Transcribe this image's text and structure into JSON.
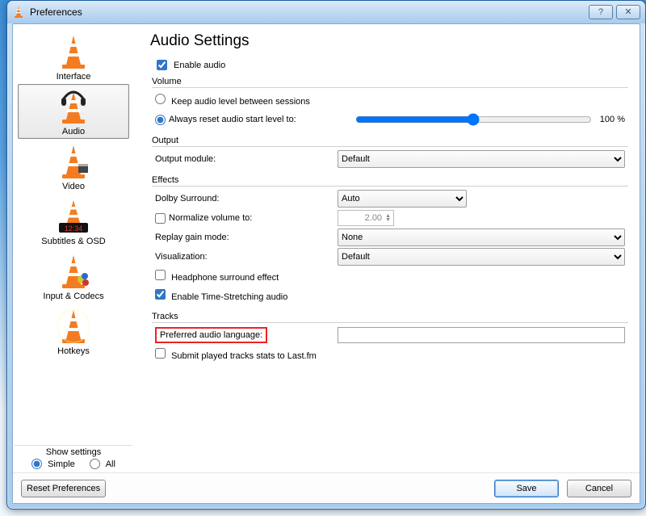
{
  "window": {
    "title": "Preferences"
  },
  "sidebar": {
    "items": [
      {
        "label": "Interface"
      },
      {
        "label": "Audio"
      },
      {
        "label": "Video"
      },
      {
        "label": "Subtitles & OSD"
      },
      {
        "label": "Input & Codecs"
      },
      {
        "label": "Hotkeys"
      }
    ],
    "show_label": "Show settings",
    "simple_label": "Simple",
    "all_label": "All"
  },
  "main": {
    "heading": "Audio Settings",
    "enable_audio_label": "Enable audio",
    "volume": {
      "group_title": "Volume",
      "keep_label": "Keep audio level between sessions",
      "reset_label": "Always reset audio start level to:",
      "level_value": 100,
      "level_suffix": " %"
    },
    "output": {
      "group_title": "Output",
      "module_label": "Output module:",
      "module_value": "Default"
    },
    "effects": {
      "group_title": "Effects",
      "dolby_label": "Dolby Surround:",
      "dolby_value": "Auto",
      "normalize_label": "Normalize volume to:",
      "normalize_value": "2.00",
      "replay_label": "Replay gain mode:",
      "replay_value": "None",
      "viz_label": "Visualization:",
      "viz_value": "Default",
      "headphone_label": "Headphone surround effect",
      "timestretch_label": "Enable Time-Stretching audio"
    },
    "tracks": {
      "group_title": "Tracks",
      "pref_lang_label": "Preferred audio language:",
      "pref_lang_value": "",
      "lastfm_label": "Submit played tracks stats to Last.fm"
    }
  },
  "footer": {
    "reset_label": "Reset Preferences",
    "save_label": "Save",
    "cancel_label": "Cancel"
  }
}
